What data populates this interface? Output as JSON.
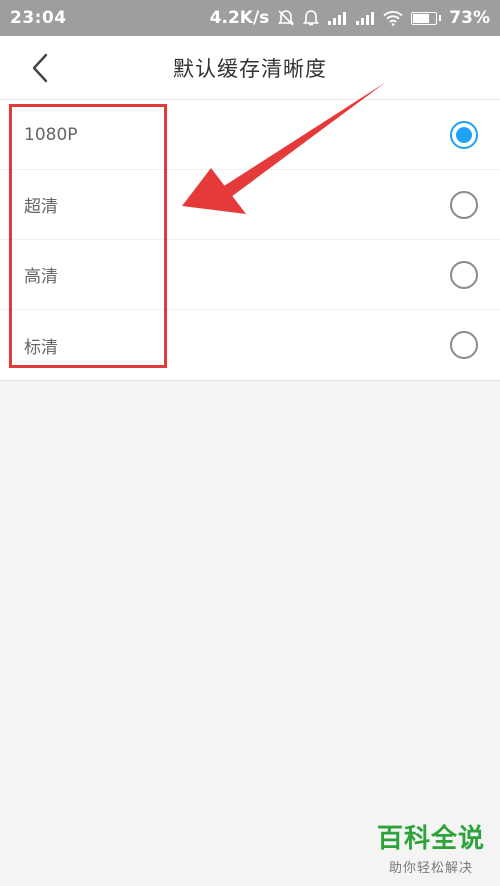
{
  "status_bar": {
    "time": "23:04",
    "net_speed": "4.2K/s",
    "battery": "73%",
    "battery_level": 0.73,
    "icons": [
      "mute-icon",
      "alarm-icon",
      "signal-icon",
      "signal-icon",
      "wifi-icon",
      "battery-icon"
    ]
  },
  "header": {
    "title": "默认缓存清晰度",
    "back_icon": "chevron-left-icon"
  },
  "options": [
    {
      "label": "1080P",
      "selected": true
    },
    {
      "label": "超清",
      "selected": false
    },
    {
      "label": "高清",
      "selected": false
    },
    {
      "label": "标清",
      "selected": false
    }
  ],
  "colors": {
    "accent": "#1ea2f2",
    "annotation": "#e43a3a",
    "watermark": "#2fa33b"
  },
  "watermark": {
    "title": "百科全说",
    "subtitle": "助你轻松解决"
  }
}
